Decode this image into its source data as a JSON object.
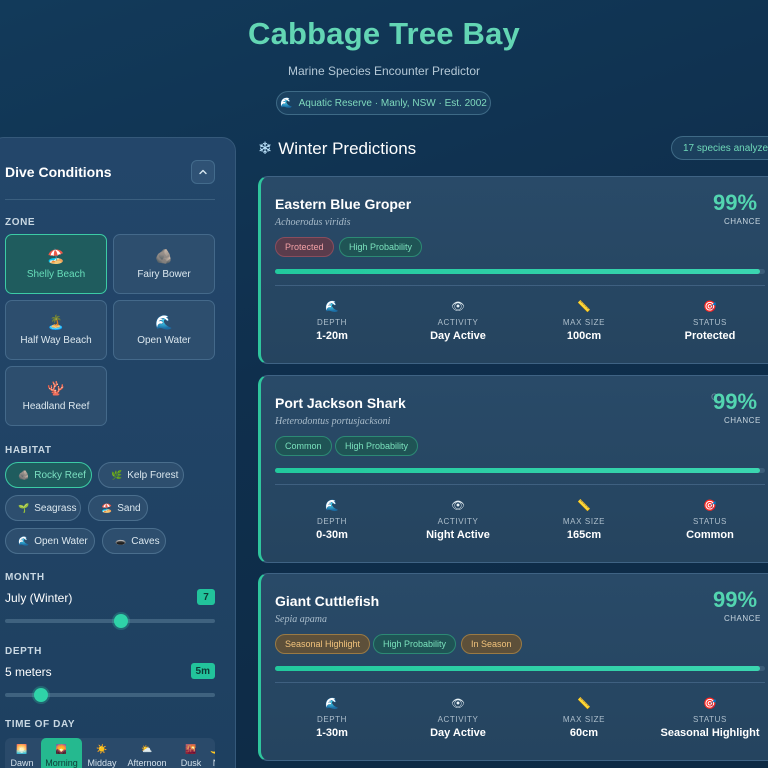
{
  "header": {
    "title": "Cabbage Tree Bay",
    "subtitle": "Marine Species Encounter Predictor",
    "pill_icon": "🌊",
    "pill_text": "Aquatic Reserve · Manly, NSW · Est. 2002"
  },
  "sidebar": {
    "title": "Dive Conditions",
    "collapse_icon": "chevron-up-icon",
    "zone_label": "ZONE",
    "zones": [
      {
        "emoji": "🏖️",
        "label": "Shelly Beach",
        "active": true
      },
      {
        "emoji": "🪨",
        "label": "Fairy Bower",
        "active": false
      },
      {
        "emoji": "🏝️",
        "label": "Half Way Beach",
        "active": false
      },
      {
        "emoji": "🌊",
        "label": "Open Water",
        "active": false
      },
      {
        "emoji": "🪸",
        "label": "Headland Reef",
        "active": false
      }
    ],
    "habitat_label": "HABITAT",
    "habitats": [
      {
        "emoji": "🪨",
        "label": "Rocky Reef",
        "active": true
      },
      {
        "emoji": "🌿",
        "label": "Kelp Forest",
        "active": false
      },
      {
        "emoji": "🌱",
        "label": "Seagrass",
        "active": false
      },
      {
        "emoji": "🏖️",
        "label": "Sand",
        "active": false
      },
      {
        "emoji": "🌊",
        "label": "Open Water",
        "active": false
      },
      {
        "emoji": "🕳️",
        "label": "Caves",
        "active": false
      }
    ],
    "month_label": "MONTH",
    "month_value_text": "July (Winter)",
    "month_badge": "7",
    "month_slider_fraction": 0.55,
    "depth_label": "DEPTH",
    "depth_value_text": "5 meters",
    "depth_badge": "5m",
    "depth_slider_fraction": 0.17,
    "time_label": "TIME OF DAY",
    "times": [
      {
        "emoji": "🌅",
        "label": "Dawn",
        "active": false
      },
      {
        "emoji": "🌄",
        "label": "Morning",
        "active": true
      },
      {
        "emoji": "☀️",
        "label": "Midday",
        "active": false
      },
      {
        "emoji": "⛅",
        "label": "Afternoon",
        "active": false
      },
      {
        "emoji": "🌇",
        "label": "Dusk",
        "active": false
      },
      {
        "emoji": "🌙",
        "label": "N",
        "active": false
      }
    ]
  },
  "main": {
    "season_icon": "❄",
    "season_title": "Winter Predictions",
    "species_count": "17 species analyze"
  },
  "cards": [
    {
      "name": "Eastern Blue Groper",
      "scientific": "Achoerodus viridis",
      "percent": "99%",
      "chance_label": "CHANCE",
      "ghost": "",
      "probability": 0.99,
      "tags": [
        {
          "text": "Protected",
          "style": "red"
        },
        {
          "text": "High Probability",
          "style": "green"
        }
      ],
      "stats": [
        {
          "icon": "🌊",
          "label": "DEPTH",
          "value": "1-20m"
        },
        {
          "icon": "👁",
          "label": "ACTIVITY",
          "value": "Day Active"
        },
        {
          "icon": "📏",
          "label": "MAX SIZE",
          "value": "100cm"
        },
        {
          "icon": "🎯",
          "label": "STATUS",
          "value": "Protected"
        }
      ]
    },
    {
      "name": "Port Jackson Shark",
      "scientific": "Heterodontus portusjacksoni",
      "percent": "99%",
      "chance_label": "CHANCE",
      "ghost": "C",
      "probability": 0.99,
      "tags": [
        {
          "text": "Common",
          "style": "green"
        },
        {
          "text": "High Probability",
          "style": "green"
        }
      ],
      "stats": [
        {
          "icon": "🌊",
          "label": "DEPTH",
          "value": "0-30m"
        },
        {
          "icon": "👁",
          "label": "ACTIVITY",
          "value": "Night Active"
        },
        {
          "icon": "📏",
          "label": "MAX SIZE",
          "value": "165cm"
        },
        {
          "icon": "🎯",
          "label": "STATUS",
          "value": "Common"
        }
      ]
    },
    {
      "name": "Giant Cuttlefish",
      "scientific": "Sepia apama",
      "percent": "99%",
      "chance_label": "CHANCE",
      "ghost": "",
      "probability": 0.99,
      "tags": [
        {
          "text": "Seasonal Highlight",
          "style": "amber"
        },
        {
          "text": "High Probability",
          "style": "green"
        },
        {
          "text": "In Season",
          "style": "amber"
        }
      ],
      "stats": [
        {
          "icon": "🌊",
          "label": "DEPTH",
          "value": "1-30m"
        },
        {
          "icon": "👁",
          "label": "ACTIVITY",
          "value": "Day Active"
        },
        {
          "icon": "📏",
          "label": "MAX SIZE",
          "value": "60cm"
        },
        {
          "icon": "🎯",
          "label": "STATUS",
          "value": "Seasonal Highlight"
        }
      ]
    }
  ]
}
